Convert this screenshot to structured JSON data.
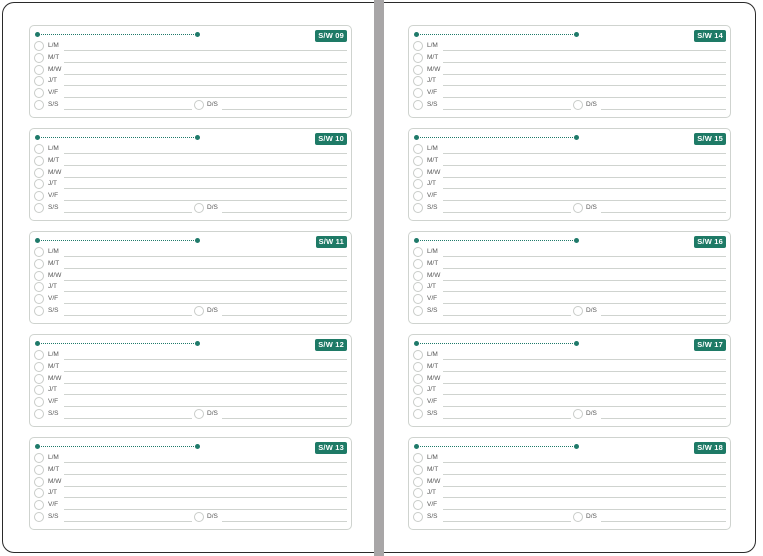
{
  "days": [
    "L/M",
    "M/T",
    "M/W",
    "J/T",
    "V/F",
    "S/S"
  ],
  "sunday": "D/S",
  "left_weeks": [
    "S/W 09",
    "S/W 10",
    "S/W 11",
    "S/W 12",
    "S/W 13"
  ],
  "right_weeks": [
    "S/W 14",
    "S/W 15",
    "S/W 16",
    "S/W 17",
    "S/W 18"
  ],
  "colors": {
    "accent": "#1e7a66",
    "rule": "#cfd3cf",
    "gutter": "#a8a6a7"
  }
}
